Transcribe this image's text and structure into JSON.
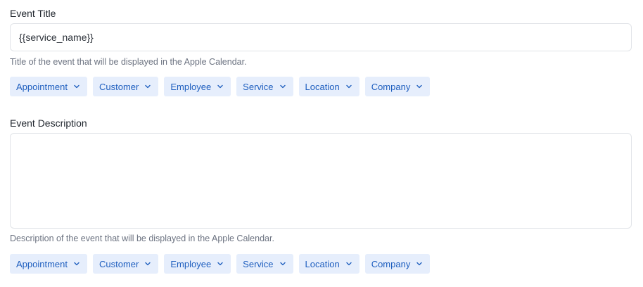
{
  "title_section": {
    "label": "Event Title",
    "value": "{{service_name}}",
    "hint": "Title of the event that will be displayed in the Apple Calendar."
  },
  "description_section": {
    "label": "Event Description",
    "value": "",
    "hint": "Description of the event that will be displayed in the Apple Calendar."
  },
  "placeholder_chips": [
    "Appointment",
    "Customer",
    "Employee",
    "Service",
    "Location",
    "Company"
  ],
  "icons": {
    "chip_dropdown": "chevron-down-icon"
  },
  "colors": {
    "chip_bg": "#e6eefc",
    "chip_text": "#1f5fbf",
    "border": "#e1e4e8",
    "hint": "#6b7280"
  }
}
